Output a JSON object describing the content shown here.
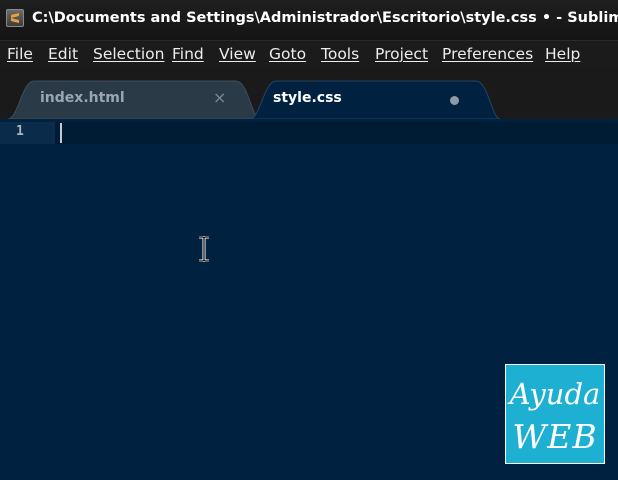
{
  "window": {
    "title": "C:\\Documents and Settings\\Administrador\\Escritorio\\style.css • - Sublime Text"
  },
  "menu": {
    "items": [
      "File",
      "Edit",
      "Selection",
      "Find",
      "View",
      "Goto",
      "Tools",
      "Project",
      "Preferences",
      "Help"
    ]
  },
  "tabs": [
    {
      "label": "index.html",
      "state": "inactive",
      "indicator": "close-icon"
    },
    {
      "label": "style.css",
      "state": "active",
      "indicator": "unsaved-dot-icon"
    }
  ],
  "editor": {
    "line_numbers": [
      "1"
    ],
    "content": ""
  },
  "colors": {
    "editor_background": "#002240",
    "titlebar": "#141414",
    "menubar": "#1b1b1b",
    "logo_background": "#1eb0d2"
  },
  "watermark": {
    "line1": "Ayuda",
    "line2": "WEB"
  }
}
